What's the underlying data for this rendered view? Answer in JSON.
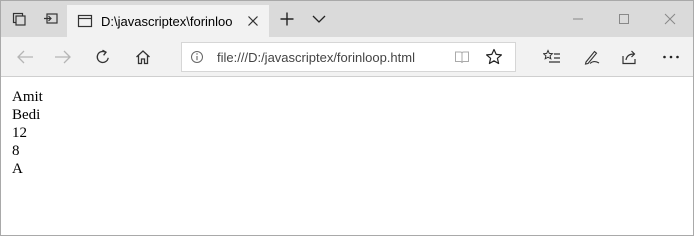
{
  "tab": {
    "title": "D:\\javascriptex\\forinloo",
    "close_label": "×"
  },
  "addressbar": {
    "url": "file:///D:/javascriptex/forinloop.html"
  },
  "page": {
    "lines": [
      "Amit",
      "Bedi",
      "12",
      "8",
      "A"
    ]
  },
  "icons": {
    "tab_preview": "tab-preview-icon",
    "set_aside": "set-aside-tabs-icon",
    "page": "page-icon",
    "new_tab": "plus-icon",
    "tab_list": "chevron-down-icon",
    "minimize": "minimize-icon",
    "maximize": "maximize-icon",
    "close": "close-icon",
    "back": "back-arrow-icon",
    "forward": "forward-arrow-icon",
    "refresh": "refresh-icon",
    "home": "home-icon",
    "info": "info-icon",
    "reading_view": "reading-view-icon",
    "favorite": "star-icon",
    "favorites_hub": "favorites-list-icon",
    "notes": "pen-icon",
    "share": "share-icon",
    "more": "more-icon"
  },
  "colors": {
    "chrome": "#dadada",
    "tab_active": "#f2f2f2",
    "toolbar": "#f2f2f2",
    "page_bg": "#ffffff"
  }
}
